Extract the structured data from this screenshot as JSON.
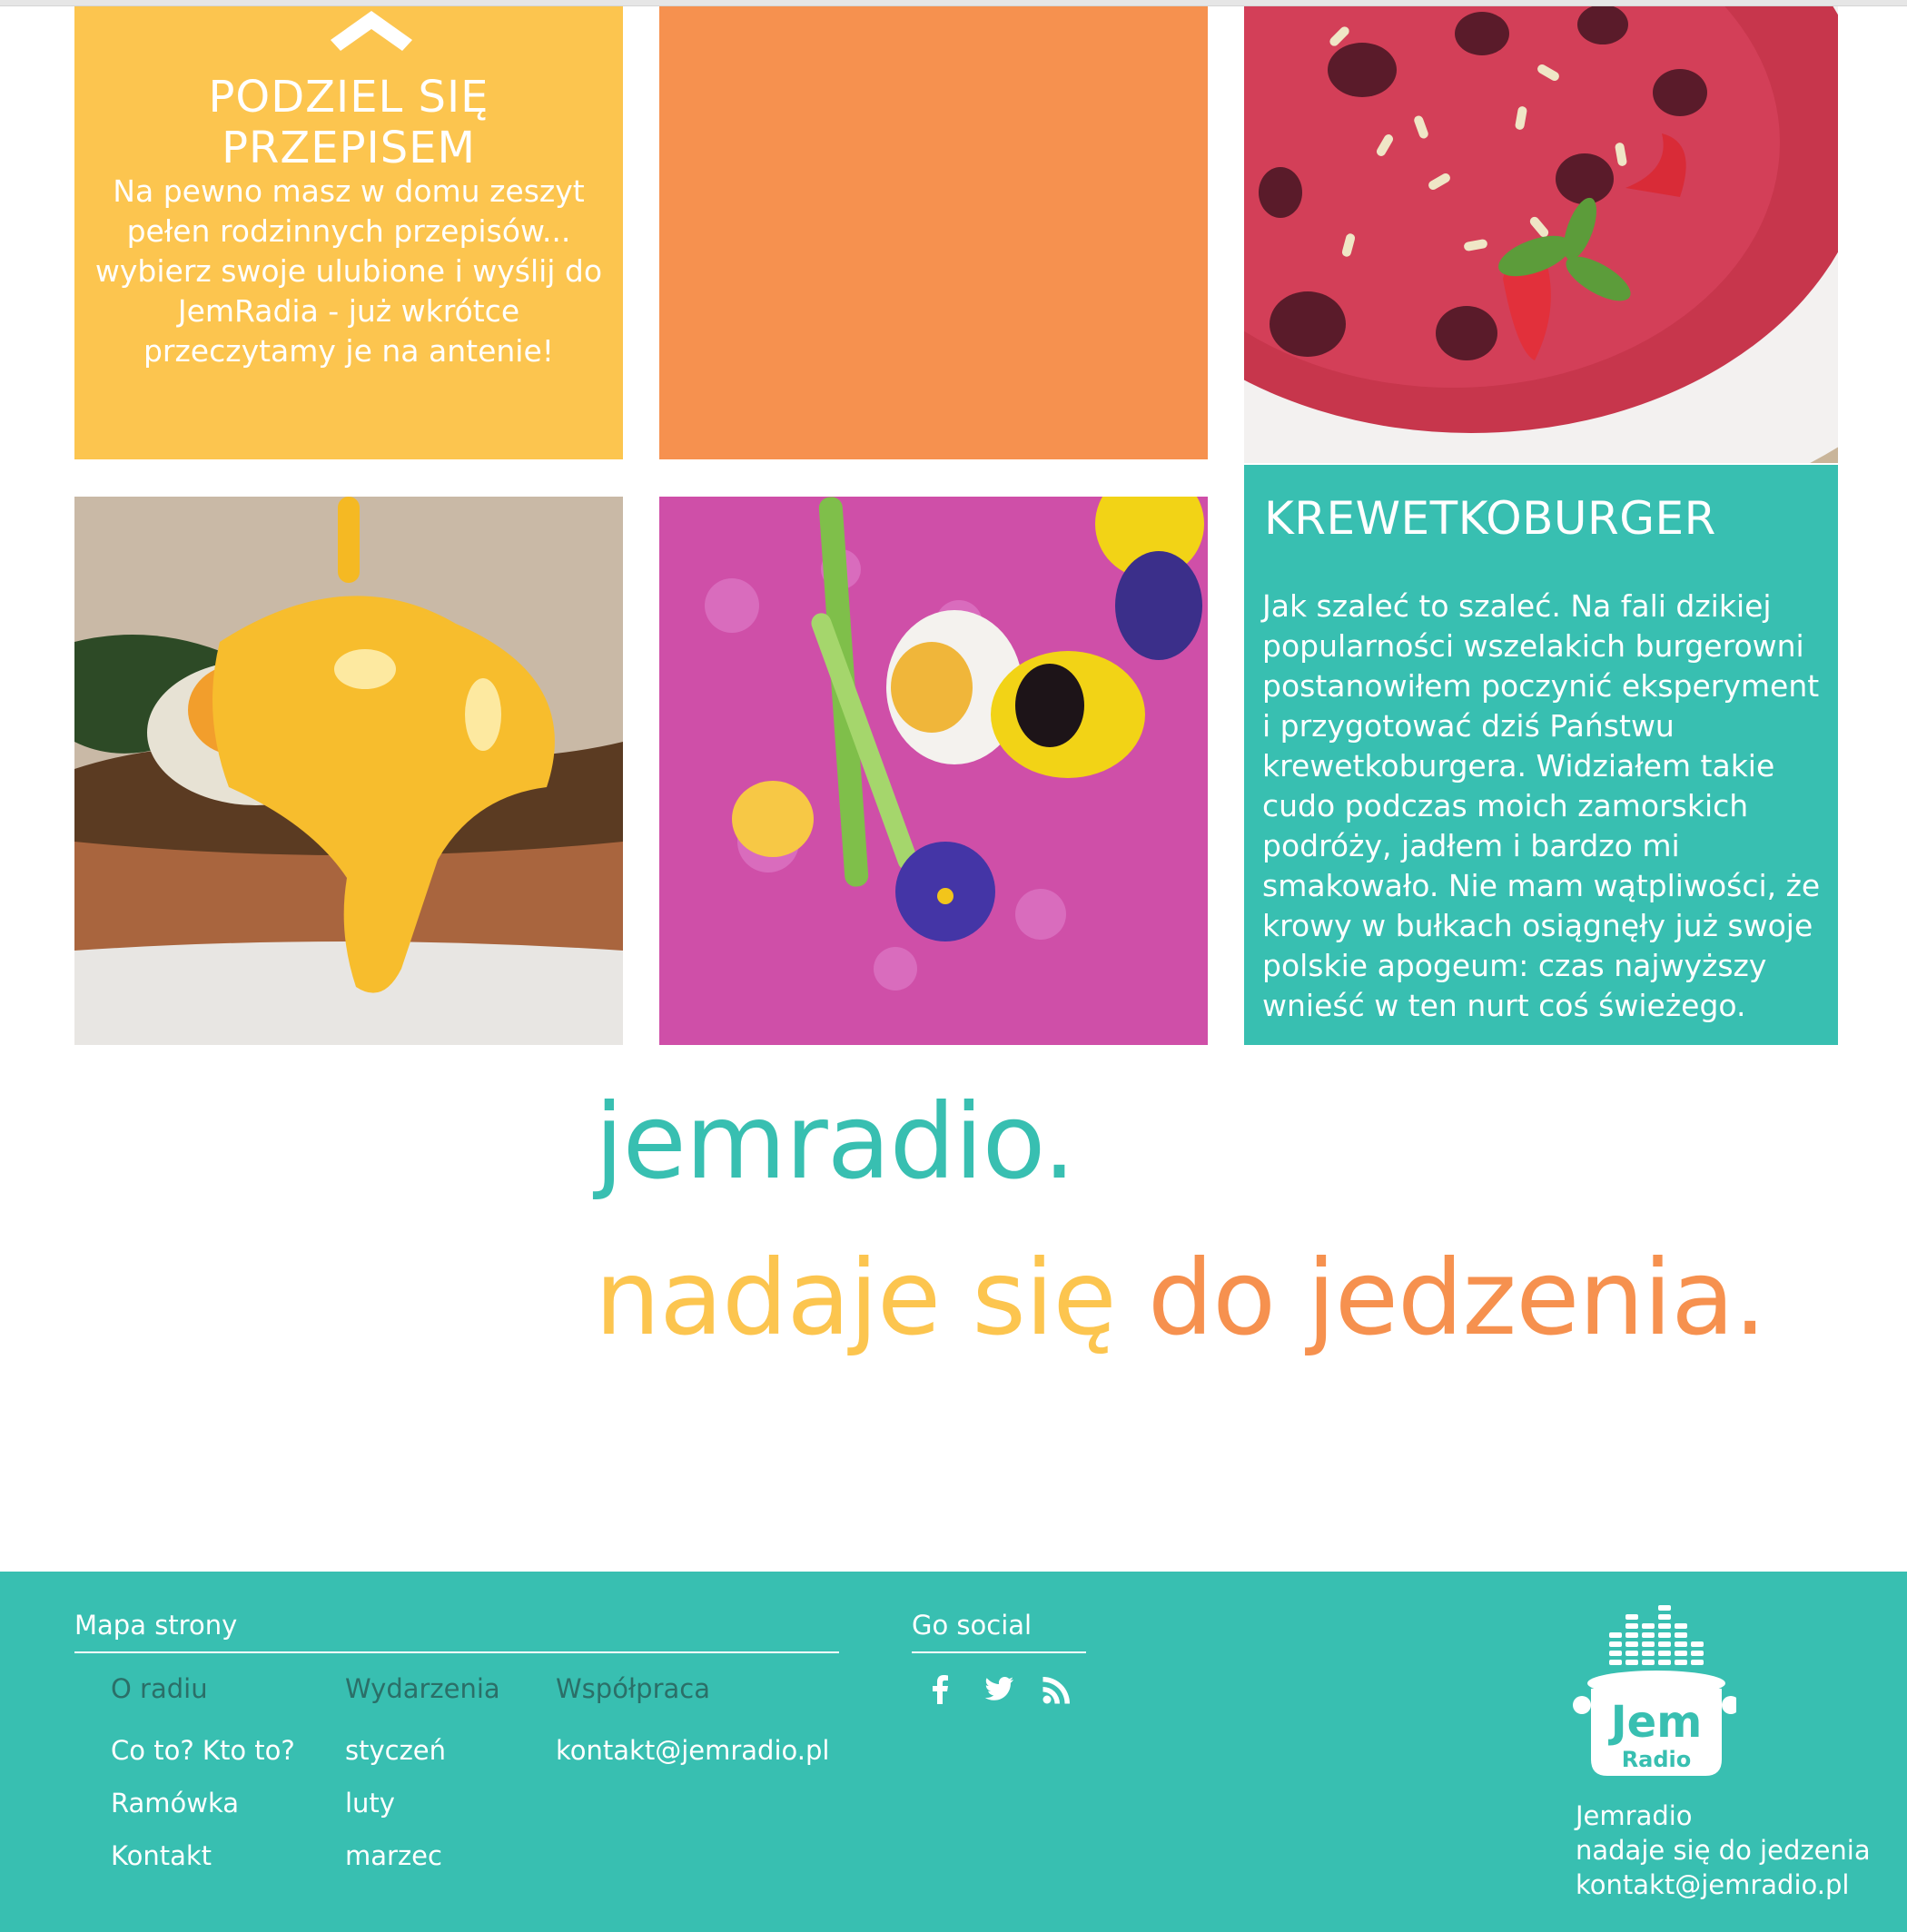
{
  "tiles": {
    "share": {
      "title": "PODZIEL SIĘ PRZEPISEM",
      "text": "Na pewno masz w domu zeszyt pełen rodzinnych przepisów... wybierz swoje ulubione i wyślij do JemRadia - już wkrótce przeczytamy je na antenie!"
    },
    "krewetkoburger": {
      "title": "KREWETKOBURGER",
      "text": "Jak szaleć to szaleć. Na fali dzikiej popularności wszelakich burgerowni postanowiłem poczynić eksperyment i przygotować dziś Państwu krewetkoburgera. Widziałem takie cudo podczas moich zamorskich podróży, jadłem i bardzo mi smakowało. Nie mam wątpliwości, że krowy w bułkach osiągnęły już swoje polskie apogeum: czas najwyższy wnieść w ten nurt coś świeżego."
    }
  },
  "slogan": {
    "line1": "jemradio.",
    "line2a": "nadaje się ",
    "line2b": "do jedzenia."
  },
  "footer": {
    "sitemap_title": "Mapa strony",
    "columns": [
      {
        "heading": "O radiu",
        "links": [
          "Co to? Kto to?",
          "Ramówka",
          "Kontakt"
        ]
      },
      {
        "heading": "Wydarzenia",
        "links": [
          "styczeń",
          "luty",
          "marzec"
        ]
      },
      {
        "heading": "Współpraca",
        "links": [
          "kontakt@jemradio.pl"
        ]
      }
    ],
    "social_title": "Go social",
    "social_icons": [
      "facebook-icon",
      "twitter-icon",
      "rss-icon"
    ],
    "info": [
      "Jemradio",
      "nadaje się do jedzenia",
      "kontakt@jemradio.pl"
    ],
    "logo_text": {
      "top": "Jem",
      "bottom": "Radio"
    }
  },
  "colors": {
    "teal": "#38bfb1",
    "yellow": "#fcc54f",
    "orange": "#f6914f",
    "teal_dark_text": "#2b6f68"
  }
}
